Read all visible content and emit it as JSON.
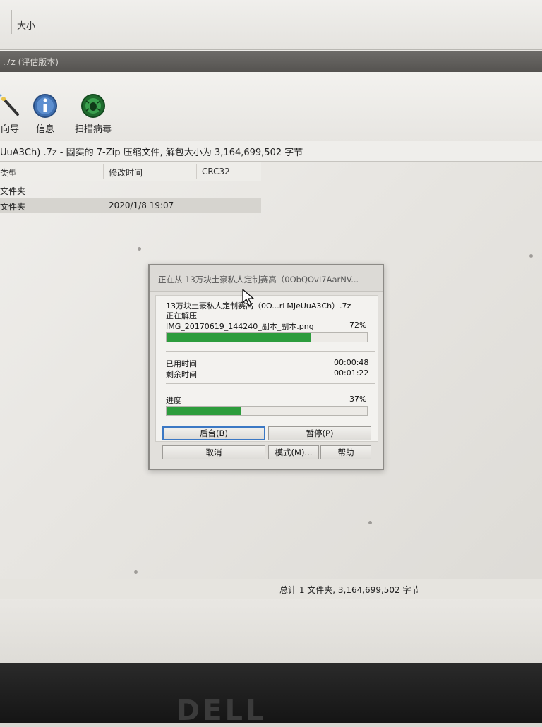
{
  "top_header": {
    "size_label": "大小"
  },
  "window_title": ".7z (评估版本)",
  "toolbar": {
    "items": [
      {
        "label": "向导",
        "icon": "wand-icon"
      },
      {
        "label": "信息",
        "icon": "info-icon"
      },
      {
        "label": "扫描病毒",
        "icon": "virus-scan-icon"
      }
    ]
  },
  "path_bar": {
    "text": "UuA3Ch) .7z - 固实的 7-Zip 压缩文件, 解包大小为 3,164,699,502 字节"
  },
  "file_list": {
    "columns": [
      "类型",
      "修改时间",
      "CRC32"
    ],
    "rows": [
      {
        "type": "文件夹",
        "modified": "",
        "crc": ""
      },
      {
        "type": "文件夹",
        "modified": "2020/1/8 19:07",
        "crc": ""
      }
    ]
  },
  "status_bar": {
    "text": "总计 1 文件夹, 3,164,699,502 字节"
  },
  "dialog": {
    "title": "正在从 13万块土豪私人定制赛高（0ObQOvI7AarNV...",
    "archive_name": "13万块土豪私人定制赛高（0O...rLMJeUuA3Ch）.7z",
    "action": "正在解压",
    "current_file": "IMG_20170619_144240_副本_副本.png",
    "file_percent_label": "72%",
    "file_progress": 0.72,
    "elapsed_label": "已用时间",
    "elapsed_value": "00:00:48",
    "remaining_label": "剩余时间",
    "remaining_value": "00:01:22",
    "overall_label": "进度",
    "overall_percent_label": "37%",
    "overall_progress": 0.37,
    "buttons": {
      "background": "后台(B)",
      "pause": "暂停(P)",
      "cancel": "取消",
      "mode": "模式(M)...",
      "help": "帮助"
    }
  },
  "colors": {
    "progress_fill": "#2c9c3c",
    "default_button_border": "#3b78c4"
  },
  "bezel": {
    "brand": "DELL"
  }
}
